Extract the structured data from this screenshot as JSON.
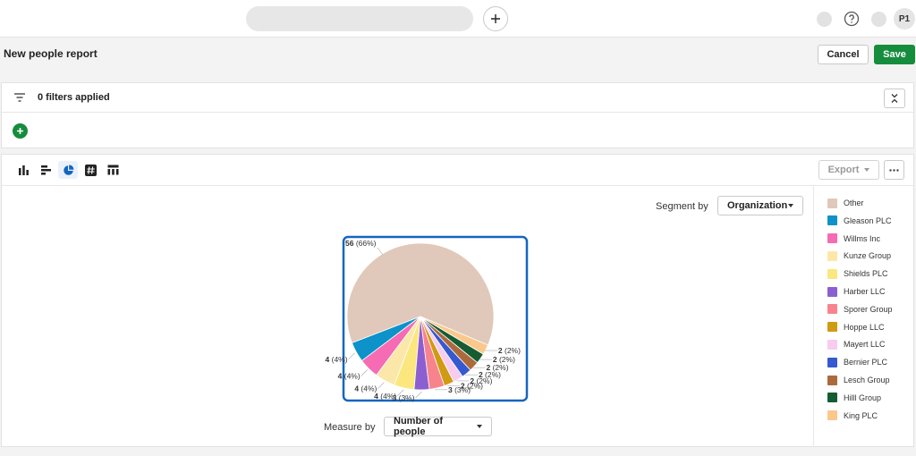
{
  "header": {
    "avatar_initials": "P1"
  },
  "page": {
    "title": "New people report",
    "cancel_label": "Cancel",
    "save_label": "Save"
  },
  "filters": {
    "label": "0 filters applied"
  },
  "toolbar": {
    "tools": [
      "column-chart-icon",
      "bar-chart-icon",
      "pie-chart-icon",
      "number-icon",
      "table-icon"
    ],
    "active_tool": "pie-chart-icon",
    "export_label": "Export"
  },
  "controls": {
    "segment_label": "Segment by",
    "segment_value": "Organization",
    "measure_label": "Measure by",
    "measure_value": "Number of people"
  },
  "colors": {
    "accent_green": "#168c3d",
    "selection_blue": "#1565c0"
  },
  "chart_data": {
    "type": "pie",
    "series": [
      {
        "name": "Other",
        "value": 56,
        "label": "56 (66%)",
        "color": "#e0c8ba"
      },
      {
        "name": "Gleason PLC",
        "value": 4,
        "label": "4 (4%)",
        "color": "#0d92c9"
      },
      {
        "name": "Willms Inc",
        "value": 4,
        "label": "4 (4%)",
        "color": "#f56bb4"
      },
      {
        "name": "Kunze Group",
        "value": 4,
        "label": "4 (4%)",
        "color": "#fbe8a8"
      },
      {
        "name": "Shields PLC",
        "value": 4,
        "label": "4 (4%)",
        "color": "#fbe77e"
      },
      {
        "name": "Harber LLC",
        "value": 3,
        "label": "3 (3%)",
        "color": "#8c5fd1"
      },
      {
        "name": "Sporer Group",
        "value": 3,
        "label": "3 (3%)",
        "color": "#f7848d"
      },
      {
        "name": "Hoppe LLC",
        "value": 2,
        "label": "2 (2%)",
        "color": "#d09a14"
      },
      {
        "name": "Mayert LLC",
        "value": 2,
        "label": "2 (2%)",
        "color": "#f7ccef"
      },
      {
        "name": "Bernier PLC",
        "value": 2,
        "label": "2 (2%)",
        "color": "#3659d0"
      },
      {
        "name": "Lesch Group",
        "value": 2,
        "label": "2 (2%)",
        "color": "#ac6a3c"
      },
      {
        "name": "Hilll Group",
        "value": 2,
        "label": "2 (2%)",
        "color": "#165c33"
      },
      {
        "name": "King PLC",
        "value": 2,
        "label": "2 (2%)",
        "color": "#fbc88c"
      }
    ]
  }
}
